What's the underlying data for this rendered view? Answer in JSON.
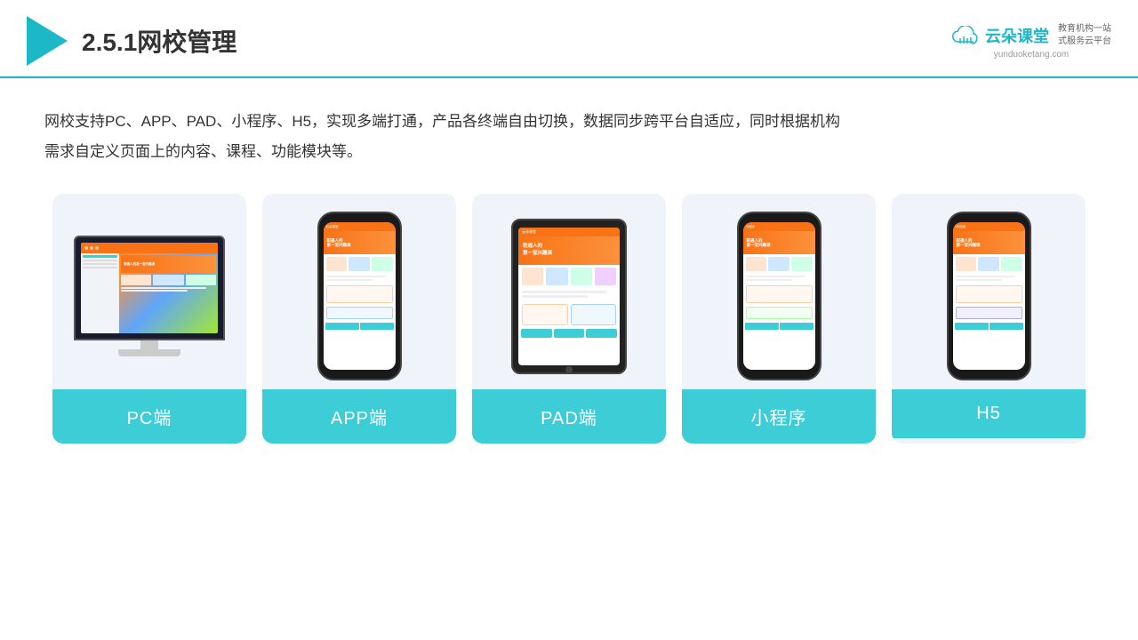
{
  "header": {
    "title": "2.5.1网校管理",
    "brand": {
      "name": "云朵课堂",
      "url": "yunduoketang.com",
      "tagline": "教育机构一站\n式服务云平台"
    }
  },
  "description": {
    "text": "网校支持PC、APP、PAD、小程序、H5，实现多端打通，产品各终端自由切换，数据同步跨平台自适应，同时根据机构\n需求自定义页面上的内容、课程、功能模块等。"
  },
  "cards": [
    {
      "id": "pc",
      "label": "PC端",
      "type": "pc"
    },
    {
      "id": "app",
      "label": "APP端",
      "type": "phone"
    },
    {
      "id": "pad",
      "label": "PAD端",
      "type": "tablet"
    },
    {
      "id": "mini",
      "label": "小程序",
      "type": "phone"
    },
    {
      "id": "h5",
      "label": "H5",
      "type": "phone"
    }
  ],
  "colors": {
    "teal": "#3ccdd6",
    "teal_dark": "#1db8c8",
    "accent_orange": "#f97316",
    "accent_blue": "#60a5fa"
  }
}
